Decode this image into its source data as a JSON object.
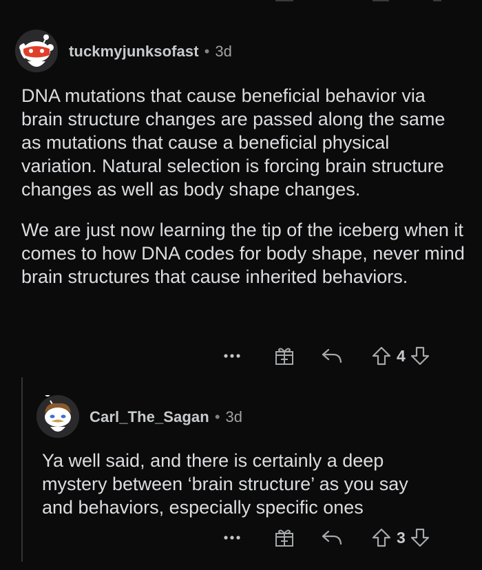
{
  "comments": [
    {
      "username": "tuckmyjunksofast",
      "separator": "•",
      "age": "3d",
      "paragraphs": [
        "DNA mutations that cause beneficial behavior via brain structure changes are passed along the same as mutations that cause a beneficial physical variation. Natural selection is forcing brain structure changes as well as body shape changes.",
        "We are just now learning the tip of the iceberg when it comes to how DNA codes for body shape, never mind brain structures that cause inherited behaviors."
      ],
      "actions": {
        "more_icon": "more-dots-icon",
        "award_icon": "gift-award-icon",
        "reply_icon": "reply-arrow-icon",
        "upvote_icon": "upvote-arrow-icon",
        "score": "4",
        "downvote_icon": "downvote-arrow-icon"
      }
    },
    {
      "username": "Carl_The_Sagan",
      "separator": "•",
      "age": "3d",
      "paragraphs": [
        "Ya well said, and there is certainly a deep mystery between ‘brain structure’ as you say and behaviors, especially specific ones"
      ],
      "actions": {
        "more_icon": "more-dots-icon",
        "award_icon": "gift-award-icon",
        "reply_icon": "reply-arrow-icon",
        "upvote_icon": "upvote-arrow-icon",
        "score": "3",
        "downvote_icon": "downvote-arrow-icon"
      }
    }
  ],
  "colors": {
    "background": "#0b0b0b",
    "text": "#dcdde0",
    "meta": "#c8cbcd",
    "icon": "#9a9da0",
    "avatar_red": "#e0402a"
  }
}
